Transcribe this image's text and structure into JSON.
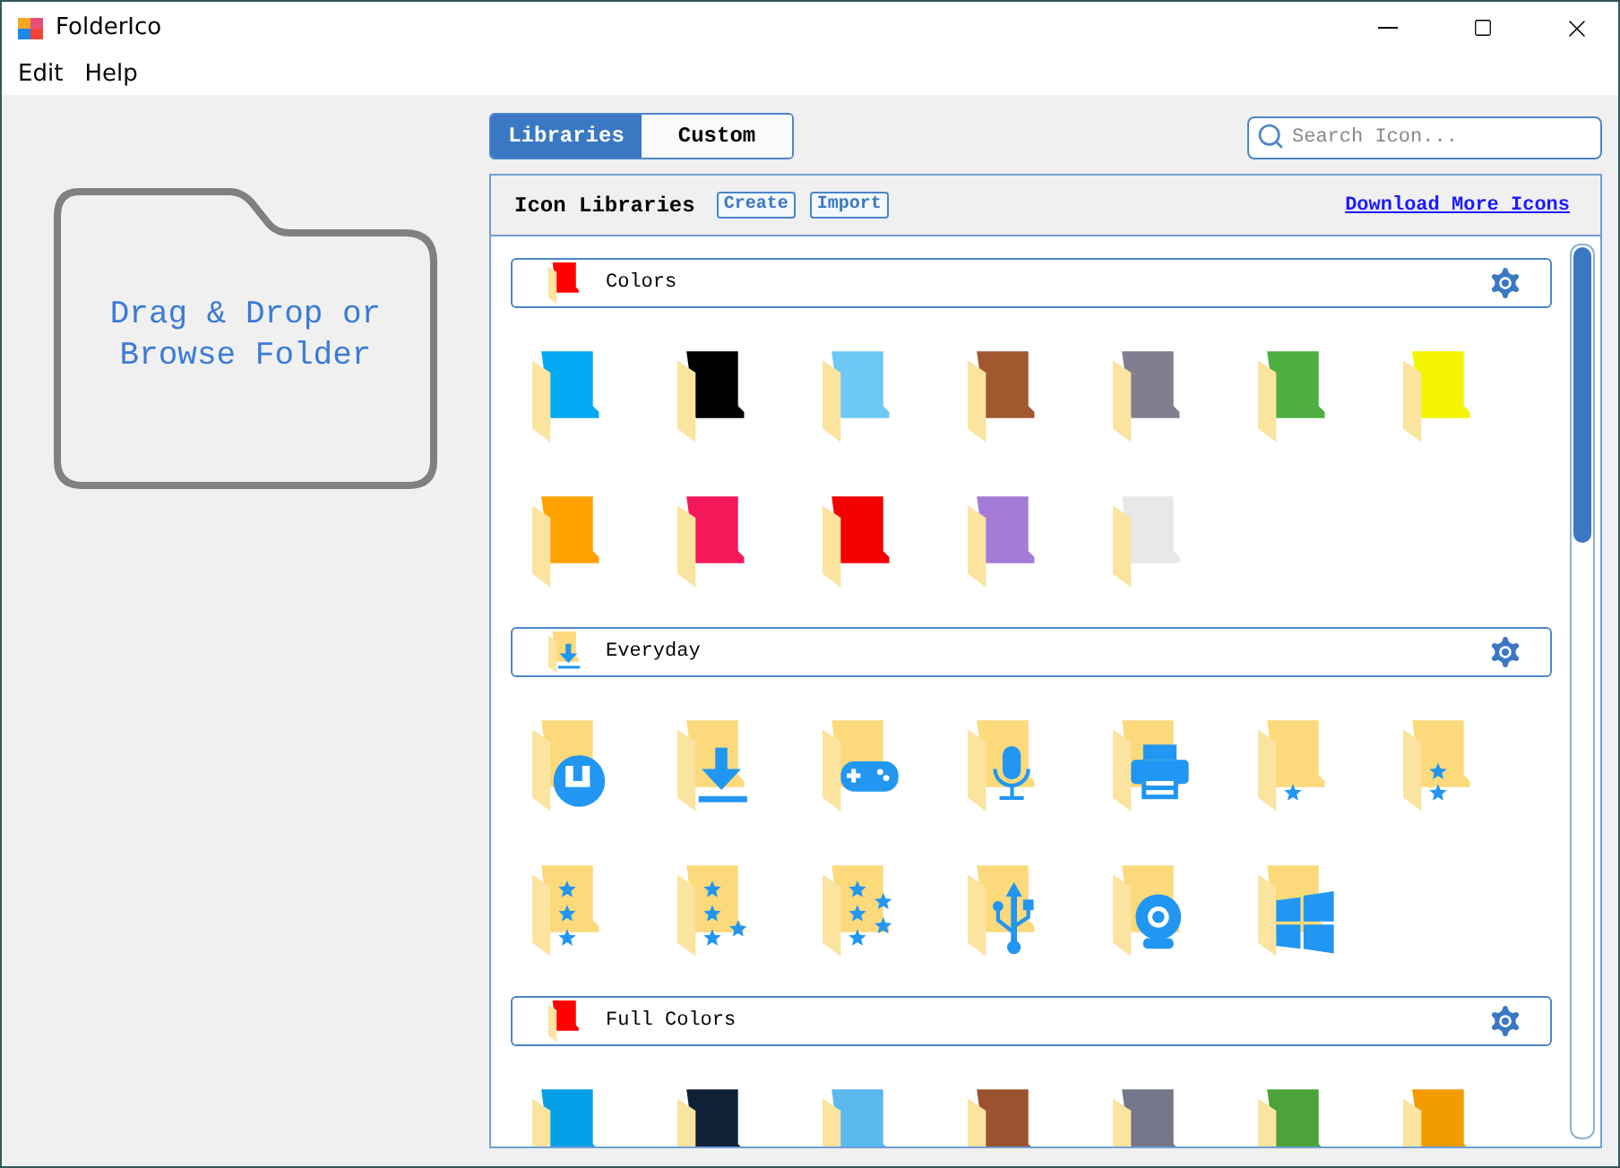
{
  "window": {
    "title": "FolderIco"
  },
  "menu": [
    "Edit",
    "Help"
  ],
  "drop_zone": {
    "text": "Drag & Drop or Browse Folder"
  },
  "tabs": [
    {
      "label": "Libraries",
      "selected": true
    },
    {
      "label": "Custom",
      "selected": false
    }
  ],
  "search": {
    "placeholder": "Search Icon..."
  },
  "library_panel": {
    "title": "Icon Libraries",
    "buttons": [
      "Create",
      "Import"
    ],
    "link": "Download More Icons",
    "sections": [
      {
        "title": "Colors",
        "header_icon": {
          "kind": "color",
          "color": "#ff0000"
        },
        "icons": [
          {
            "kind": "color",
            "color": "#03a9f4"
          },
          {
            "kind": "color",
            "color": "#000000"
          },
          {
            "kind": "color",
            "color": "#6cc8f5"
          },
          {
            "kind": "color",
            "color": "#a0582e"
          },
          {
            "kind": "color",
            "color": "#7f7f8f"
          },
          {
            "kind": "color",
            "color": "#4caf3f"
          },
          {
            "kind": "color",
            "color": "#f4f400"
          },
          {
            "kind": "color",
            "color": "#ffa200"
          },
          {
            "kind": "color",
            "color": "#f5185a"
          },
          {
            "kind": "color",
            "color": "#f50000"
          },
          {
            "kind": "color",
            "color": "#a57bd8"
          },
          {
            "kind": "color",
            "color": "#e8e8e8"
          }
        ]
      },
      {
        "title": "Everyday",
        "header_icon": {
          "kind": "download"
        },
        "icons": [
          {
            "kind": "u"
          },
          {
            "kind": "download"
          },
          {
            "kind": "gamepad"
          },
          {
            "kind": "microphone"
          },
          {
            "kind": "printer"
          },
          {
            "kind": "star1"
          },
          {
            "kind": "stars2"
          },
          {
            "kind": "stars3"
          },
          {
            "kind": "stars4"
          },
          {
            "kind": "stars5"
          },
          {
            "kind": "usb"
          },
          {
            "kind": "webcam"
          },
          {
            "kind": "windows"
          }
        ]
      },
      {
        "title": "Full Colors",
        "header_icon": {
          "kind": "color",
          "color": "#ff0000"
        },
        "icons": [
          {
            "kind": "color",
            "color": "#03a0e8"
          },
          {
            "kind": "color",
            "color": "#0f2238"
          },
          {
            "kind": "color",
            "color": "#5ab9ee"
          },
          {
            "kind": "color",
            "color": "#9a532e"
          },
          {
            "kind": "color",
            "color": "#76768a"
          },
          {
            "kind": "color",
            "color": "#4ba33a"
          },
          {
            "kind": "color",
            "color": "#f39c00"
          }
        ]
      }
    ]
  }
}
